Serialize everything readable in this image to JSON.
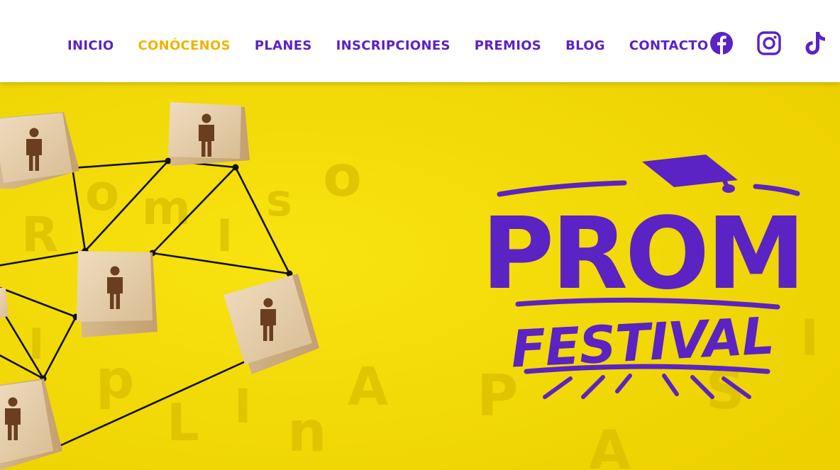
{
  "nav": {
    "items": [
      {
        "label": "INICIO",
        "active": false
      },
      {
        "label": "CONÓCENOS",
        "active": true
      },
      {
        "label": "PLANES",
        "active": false
      },
      {
        "label": "INSCRIPCIONES",
        "active": false
      },
      {
        "label": "PREMIOS",
        "active": false
      },
      {
        "label": "BLOG",
        "active": false
      },
      {
        "label": "CONTACTO",
        "active": false
      }
    ]
  },
  "social": {
    "icons": [
      "facebook-icon",
      "instagram-icon",
      "tiktok-icon"
    ]
  },
  "hero": {
    "logo_top": "PROM",
    "logo_bottom": "FESTIVAL"
  },
  "colors": {
    "brand_purple": "#5b22c4",
    "active_yellow": "#f0b400",
    "hero_yellow": "#f2d90c"
  }
}
